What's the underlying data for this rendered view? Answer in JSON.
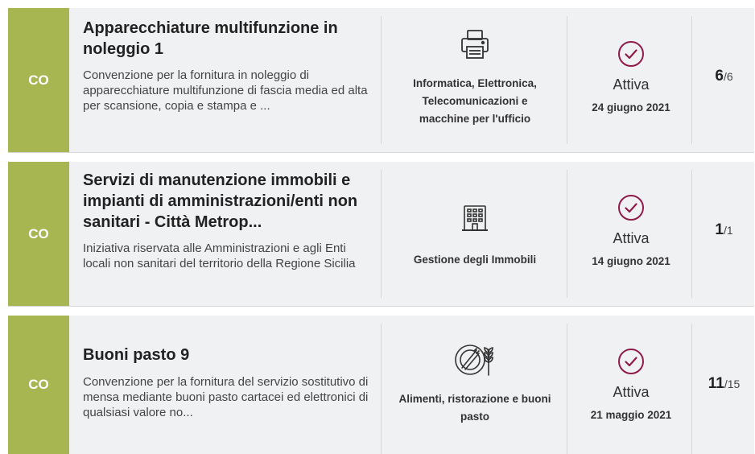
{
  "cards": [
    {
      "badge": "CO",
      "title": "Apparecchiature multifunzione in noleggio 1",
      "description": "Convenzione per la fornitura in noleggio di apparecchiature multifunzione di fascia media ed alta per scansione, copia e stampa e ...",
      "category": "Informatica, Elettronica, Telecomunicazioni e macchine per l'ufficio",
      "category_icon": "printer-icon",
      "status": "Attiva",
      "status_icon": "check-circle-icon",
      "date": "24 giugno 2021",
      "count": "6",
      "count_total": "/6"
    },
    {
      "badge": "CO",
      "title": "Servizi di manutenzione immobili e impianti di amministrazioni/enti non sanitari - Città Metrop...",
      "description": "Iniziativa riservata alle Amministrazioni e agli Enti locali non sanitari del territorio della Regione Sicilia",
      "category": "Gestione degli Immobili",
      "category_icon": "building-icon",
      "status": "Attiva",
      "status_icon": "check-circle-icon",
      "date": "14 giugno 2021",
      "count": "1",
      "count_total": "/1"
    },
    {
      "badge": "CO",
      "title": "Buoni pasto 9",
      "description": "Convenzione per la fornitura del servizio sostitutivo di mensa mediante buoni pasto cartacei ed elettronici di qualsiasi valore no...",
      "category": "Alimenti, ristorazione e buoni pasto",
      "category_icon": "food-plate-icon",
      "status": "Attiva",
      "status_icon": "check-circle-icon",
      "date": "21 maggio 2021",
      "count": "11",
      "count_total": "/15"
    }
  ],
  "colors": {
    "badge_bg": "#a8b652",
    "card_bg": "#f0f1f3",
    "status_icon": "#8e1b4a"
  }
}
